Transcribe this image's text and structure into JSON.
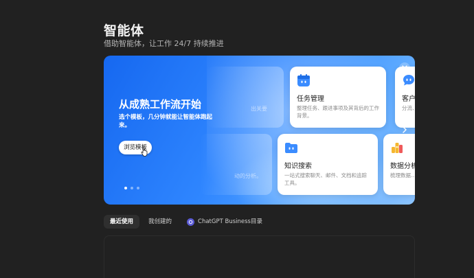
{
  "header": {
    "title": "智能体",
    "subtitle": "借助智能体，让工作 24/7 持续推进"
  },
  "banner": {
    "heading": "从成熟工作流开始",
    "description": "选个模板，几分钟就能让智能体跑起来。",
    "browse_label": "浏览模板",
    "ghost_text_1": "出关要",
    "ghost_text_2": "动的分析。",
    "active_slide": 1,
    "slide_count": 3
  },
  "cards": [
    {
      "title": "任务管理",
      "desc": "整理任务、跟进事项及其背后的工作背景。",
      "icon": "calendar-icon",
      "accent": "#3b8cff"
    },
    {
      "title": "客户",
      "desc": "分流、回复…",
      "icon": "chat-bubble-icon",
      "accent": "#3b8cff"
    },
    {
      "title": "知识搜索",
      "desc": "一站式搜索聊天、邮件、文档和追踪工具。",
      "icon": "folder-icon",
      "accent": "#3b8cff"
    },
    {
      "title": "数据分析",
      "desc": "梳理数据…",
      "icon": "bar-chart-icon",
      "accent": "#f5b72f"
    }
  ],
  "tabs": [
    {
      "label": "最近使用",
      "active": true
    },
    {
      "label": "我创建的",
      "active": false
    },
    {
      "label": "ChatGPT Business目录",
      "active": false,
      "icon": "chatgpt-logo-icon"
    }
  ],
  "colors": {
    "background": "#212121",
    "banner_blue": "#2f86ff",
    "tab_active_bg": "#2f2f2f"
  }
}
